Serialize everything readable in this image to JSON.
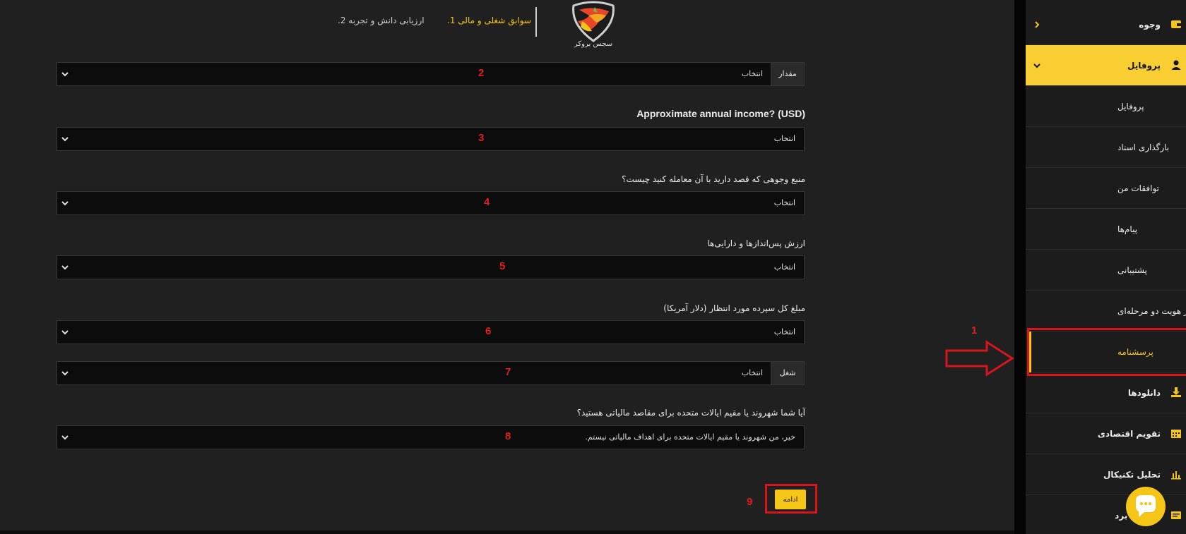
{
  "header": {
    "logo_text": "سجس بروکر",
    "step1_label": "سوابق شغلی و مالی 1.",
    "step2_label": "ارزیابی دانش و تجربه 2."
  },
  "form": {
    "fields": [
      {
        "number": "2",
        "prefix": "مقدار",
        "value": "انتخاب"
      },
      {
        "number": "3",
        "label": "Approximate annual income? (USD)",
        "value": "انتخاب"
      },
      {
        "number": "4",
        "label": "منبع وجوهی که قصد دارید با آن معامله کنید چیست؟",
        "value": "انتخاب"
      },
      {
        "number": "5",
        "label": "ارزش پس‌اندازها و دارایی‌ها",
        "value": "انتخاب"
      },
      {
        "number": "6",
        "label": "مبلغ کل سپرده مورد انتظار (دلار آمریکا)",
        "value": "انتخاب"
      },
      {
        "number": "7",
        "prefix": "شغل",
        "value": "انتخاب"
      },
      {
        "number": "8",
        "label": "آیا شما شهروند یا مقیم ایالات متحده برای مقاصد مالیاتی هستید؟",
        "value": "خیر، من شهروند یا مقیم ایالات متحده برای اهداف مالیاتی نیستم."
      }
    ],
    "continue_number": "9",
    "continue_label": "ادامه"
  },
  "sidebar": {
    "items": [
      {
        "label": "وجوه",
        "icon": "wallet-icon"
      },
      {
        "label": "پروفایل",
        "icon": "user-icon"
      },
      {
        "label": "پروفایل"
      },
      {
        "label": "بارگذاری اسناد"
      },
      {
        "label": "توافقات من"
      },
      {
        "label": "پیام‌ها"
      },
      {
        "label": "پشتیبانی"
      },
      {
        "label": "احراز هویت دو مرحله‌ای"
      },
      {
        "label": "پرسشنامه"
      },
      {
        "label": "دانلودها",
        "icon": "download-icon"
      },
      {
        "label": "تقویم اقتصادی",
        "icon": "calendar-icon"
      },
      {
        "label": "تحلیل تکنیکال",
        "icon": "bar-chart-icon"
      },
      {
        "label": "آموزش برد",
        "icon": "card-icon"
      }
    ]
  },
  "annotations": {
    "arrow_number": "1"
  },
  "colors": {
    "accent": "#f5c518",
    "annotation_red": "#e01e1e",
    "panel": "#202020",
    "field": "#0c0c0c"
  }
}
